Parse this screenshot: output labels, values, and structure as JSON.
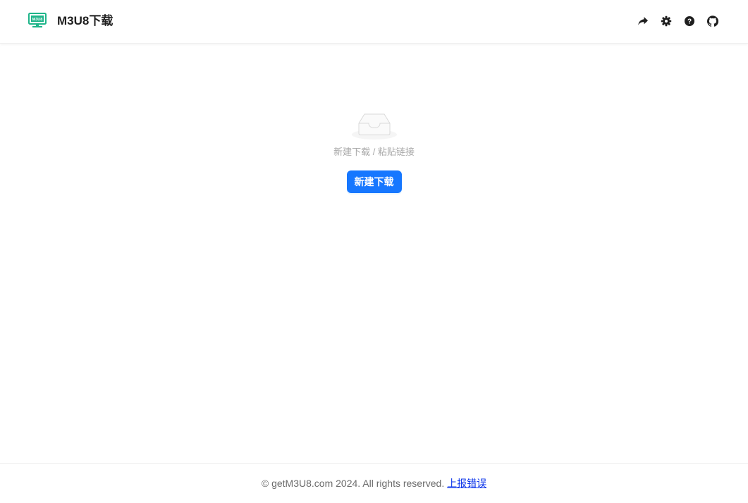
{
  "header": {
    "logo_icon": "monitor-m3u8-logo-icon",
    "title": "M3U8下载",
    "accent": "#1fb58a",
    "actions": [
      {
        "icon": "share-icon"
      },
      {
        "icon": "gear-icon"
      },
      {
        "icon": "help-icon"
      },
      {
        "icon": "github-icon"
      }
    ]
  },
  "main": {
    "empty_icon": "empty-inbox-icon",
    "description": "新建下载 / 粘贴链接",
    "new_download_label": "新建下载",
    "button_color": "#1677ff"
  },
  "footer": {
    "copyright": "© getM3U8.com 2024. All rights reserved.",
    "report_link": "上报错误"
  }
}
